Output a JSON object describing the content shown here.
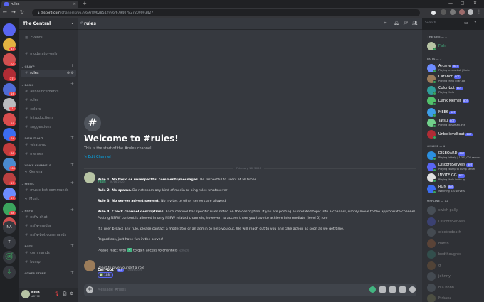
{
  "browser": {
    "tab_title": "rules",
    "tab_close": "×",
    "new_tab": "+",
    "url_domain": "discord.com",
    "url_path": "/channels/663969789628542996/679407827209093427",
    "win_min": "—",
    "win_max": "▢",
    "win_close": "✕"
  },
  "servers": {
    "badges": [
      "45",
      "101",
      "271",
      "16",
      "111",
      "19",
      "24",
      "30",
      "160",
      "29",
      "29",
      "38"
    ],
    "bottom_labels": [
      "NA",
      "T"
    ]
  },
  "sidebar": {
    "guild_name": "The Central",
    "events": "Events",
    "top": [
      {
        "label": "moderator-only"
      }
    ],
    "categories": [
      {
        "name": "GRAYP",
        "channels": [
          {
            "label": "rules",
            "active": true
          }
        ]
      },
      {
        "name": "BASIC",
        "channels": [
          {
            "label": "announcements"
          },
          {
            "label": "roles"
          },
          {
            "label": "colors"
          },
          {
            "label": "introductions"
          },
          {
            "label": "suggestions"
          }
        ]
      },
      {
        "name": "DISH IT OUT",
        "channels": [
          {
            "label": "whats-up"
          },
          {
            "label": "memes"
          }
        ]
      },
      {
        "name": "VOICE CHANNELS",
        "channels": [
          {
            "label": "General"
          }
        ]
      },
      {
        "name": "MUSIC",
        "channels": [
          {
            "label": "music-bot-commands"
          },
          {
            "label": "Music"
          }
        ]
      },
      {
        "name": "NSFW",
        "channels": [
          {
            "label": "nsfw-chat"
          },
          {
            "label": "nsfw-media"
          },
          {
            "label": "nsfw-bot-commands"
          }
        ]
      },
      {
        "name": "BOTS",
        "channels": [
          {
            "label": "commands"
          },
          {
            "label": "bump"
          }
        ]
      },
      {
        "name": "OTHER STUFF",
        "channels": []
      }
    ]
  },
  "user": {
    "name": "Fish",
    "tag": "#2702"
  },
  "header": {
    "channel": "rules",
    "search_placeholder": "Search"
  },
  "welcome": {
    "title": "Welcome to #rules!",
    "subtitle": "This is the start of the #rules channel.",
    "edit": "Edit Channel"
  },
  "divider_date": "February 16, 2020",
  "messages": [
    {
      "author": "Fish",
      "time": "06/16/2020",
      "color": "#43b581",
      "lines": [
        {
          "bold": "Rule 1: No toxic or unrespectful comments/messages.",
          "text": " Be respectful to users at all times"
        },
        {
          "bold": "Rule 2: No spams.",
          "text": " Do not spam any kind of media or ping roles whatsoever"
        },
        {
          "bold": "Rule 3: No server advertisement.",
          "text": " No invites to other servers are allowed"
        },
        {
          "bold": "Rule 4: Check channel descriptions.",
          "text": " Each channel has specific rules noted on the description. If you are posting a unrelated topic into a channel, simply move to the appropriate channel."
        },
        {
          "bold": "",
          "text": "Posting NSFW content is allowed in only NSFW related channels, however, to access them you have to achieve Intermediate (level 5) role"
        },
        {
          "bold": "",
          "text": "If a user breaks any rule, please contact a moderator or an admin to help you out. We will reach out to you and take action as soon as we get time."
        },
        {
          "bold": "",
          "text": "Regardless, just have fun in the server!"
        },
        {
          "bold": "",
          "text": "Please react with  ✅  to gain access to channels",
          "edited": "(edited)"
        }
      ]
    },
    {
      "author": "Carl-bot",
      "bot": "BOT",
      "time": "06/16/2020",
      "color": "#ffffff",
      "lines": [
        {
          "bold": "",
          "text": "React to give yourself a role"
        }
      ],
      "reaction": "✅ 108"
    }
  ],
  "composer": {
    "placeholder": "Message #rules"
  },
  "members": {
    "groups": [
      {
        "title": "THE ONE — 1",
        "items": [
          {
            "name": "Fish",
            "color": "#43b581",
            "av": "#b7c4a4"
          }
        ]
      },
      {
        "title": "BOTS — 7",
        "items": [
          {
            "name": "Arcane",
            "bot": "BOT",
            "activity": "Playing arcane.bot | !help",
            "av": "#6d8cff"
          },
          {
            "name": "Carl-bot",
            "bot": "BOT",
            "activity": "Playing !help | carl.gg",
            "av": "#9b7c5a"
          },
          {
            "name": "Color-bot",
            "bot": "BOT",
            "activity": "Playing !help",
            "av": "#2f9e9a"
          },
          {
            "name": "Dank Memer",
            "bot": "BOT",
            "activity": "",
            "av": "#52c26b"
          },
          {
            "name": "MEE6",
            "bot": "BOT",
            "activity": "",
            "av": "#3d9ee8"
          },
          {
            "name": "Tatsu",
            "bot": "BOT",
            "activity": "Playing tatsumaki.xyz",
            "av": "#71d08b"
          },
          {
            "name": "UnbelievaBoat",
            "bot": "BOT",
            "activity": "",
            "av": "#b02c35"
          }
        ]
      },
      {
        "title": "ONLINE — 4",
        "items": [
          {
            "name": "DISBOARD",
            "bot": "BOT",
            "activity": "Playing !d help | 1,375,000 servers",
            "av": "#2b8fe0"
          },
          {
            "name": "DiscordServers",
            "bot": "BOT",
            "activity": "Playing !bump to bump server",
            "av": "#5865f2"
          },
          {
            "name": "INVITE.GG",
            "bot": "BOT",
            "activity": "Playing !help invite.gg",
            "av": "#e0e0e0"
          },
          {
            "name": "RGN",
            "bot": "BOT",
            "activity": "Watching 830 servers",
            "av": "#3c6df0"
          }
        ]
      },
      {
        "title": "OFFLINE — 12",
        "items": [
          {
            "name": "swish pally",
            "av": "#7d8c9c"
          },
          {
            "name": "DiscordServers",
            "av": "#5865f2"
          },
          {
            "name": "electrodeath",
            "av": "#747f8d"
          },
          {
            "name": "Bamb",
            "av": "#b86b3c"
          },
          {
            "name": "bedthoughts",
            "av": "#3c8c7c"
          },
          {
            "name": "g",
            "av": "#9c6b3c"
          },
          {
            "name": "johnny",
            "av": "#747f8d"
          },
          {
            "name": "bla.bbbb",
            "av": "#747f8d"
          },
          {
            "name": "Mrkanz",
            "av": "#8c8c5c"
          },
          {
            "name": "Qzdan",
            "av": "#d05050"
          }
        ]
      }
    ]
  },
  "colors": {
    "accent": "#5865f2",
    "online": "#3ba55d",
    "link": "#00aff4",
    "background": "#36393f"
  }
}
